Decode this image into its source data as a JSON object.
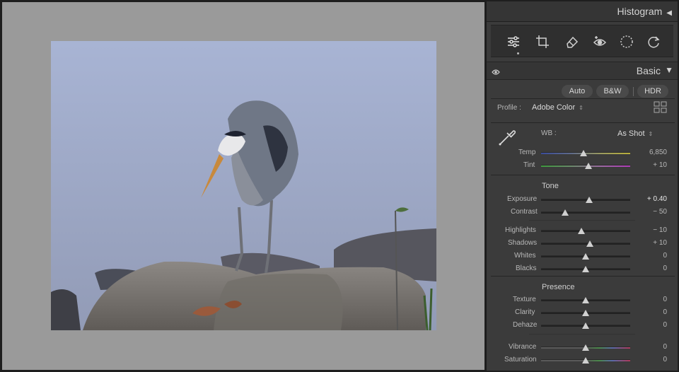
{
  "histogram": {
    "title": "Histogram"
  },
  "tools": [
    "edit-sliders",
    "crop",
    "heal-eraser",
    "red-eye",
    "masking",
    "presets"
  ],
  "basic": {
    "title": "Basic",
    "buttons": {
      "auto": "Auto",
      "bw": "B&W",
      "hdr": "HDR"
    },
    "profile": {
      "label": "Profile :",
      "value": "Adobe Color"
    },
    "wb": {
      "label": "WB :",
      "value": "As Shot"
    }
  },
  "sliders": {
    "temp": {
      "label": "Temp",
      "value": "6,850",
      "pos": 0.48
    },
    "tint": {
      "label": "Tint",
      "value": "+ 10",
      "pos": 0.53
    },
    "exposure": {
      "label": "Exposure",
      "value": "+ 0.40",
      "pos": 0.54
    },
    "contrast": {
      "label": "Contrast",
      "value": "− 50",
      "pos": 0.27
    },
    "highlights": {
      "label": "Highlights",
      "value": "− 10",
      "pos": 0.45
    },
    "shadows": {
      "label": "Shadows",
      "value": "+ 10",
      "pos": 0.55
    },
    "whites": {
      "label": "Whites",
      "value": "0",
      "pos": 0.5
    },
    "blacks": {
      "label": "Blacks",
      "value": "0",
      "pos": 0.5
    },
    "texture": {
      "label": "Texture",
      "value": "0",
      "pos": 0.5
    },
    "clarity": {
      "label": "Clarity",
      "value": "0",
      "pos": 0.5
    },
    "dehaze": {
      "label": "Dehaze",
      "value": "0",
      "pos": 0.5
    },
    "vibrance": {
      "label": "Vibrance",
      "value": "0",
      "pos": 0.5
    },
    "saturation": {
      "label": "Saturation",
      "value": "0",
      "pos": 0.5
    }
  },
  "sections": {
    "tone": "Tone",
    "presence": "Presence"
  },
  "colors": {
    "panel": "#3b3b3b",
    "canvas": "#9a9a9a",
    "thumb": "#d0d0d0"
  }
}
